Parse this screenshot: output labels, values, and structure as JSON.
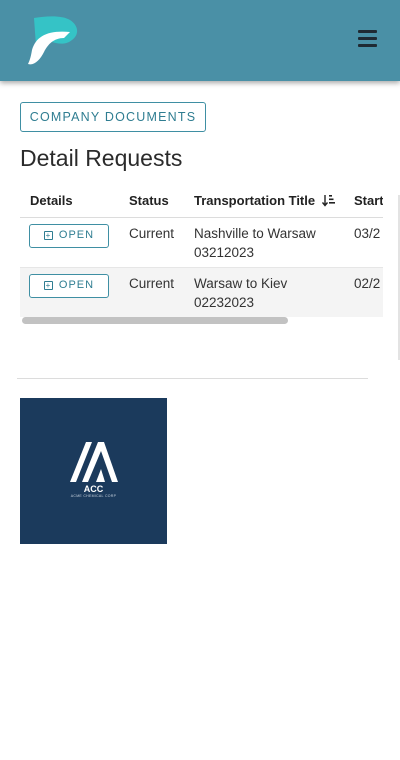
{
  "header": {
    "logo_icon": "brand-p-logo",
    "menu_icon": "hamburger-menu-icon",
    "bar_color": "#4a90a6"
  },
  "company_documents_button": {
    "label": "COMPANY DOCUMENTS"
  },
  "detail_requests": {
    "title": "Detail Requests",
    "columns": [
      "Details",
      "Status",
      "Transportation Title",
      "Start"
    ],
    "rows": [
      {
        "button": "OPEN",
        "status": "Current",
        "title_line1": "Nashville to Warsaw",
        "title_line2": "03212023",
        "start": "03/2"
      },
      {
        "button": "OPEN",
        "status": "Current",
        "title_line1": "Warsaw to Kiev",
        "title_line2": "02232023",
        "start": "02/2"
      }
    ]
  },
  "company_logo": {
    "name": "ACC",
    "subtitle": "ACME CHEMICAL CORP",
    "background": "#1b3a5c"
  }
}
